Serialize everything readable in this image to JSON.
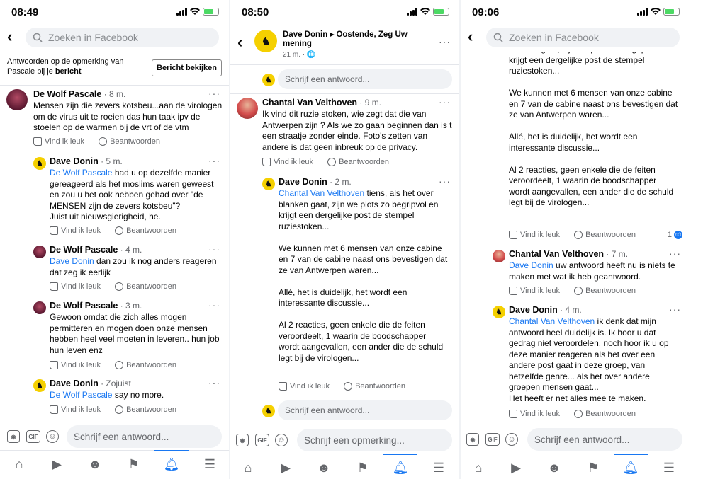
{
  "phones": [
    {
      "time": "08:49",
      "search_placeholder": "Zoeken in Facebook",
      "notice_text_1": "Antwoorden op de opmerking van",
      "notice_text_2": "Pascale bij je ",
      "notice_text_bold": "bericht",
      "notice_button": "Bericht bekijken",
      "comments": [
        {
          "name": "De Wolf Pascale",
          "time": " · 8 m.",
          "mention": "",
          "body": "Mensen zijn die zevers kotsbeu...aan de virologen\nom de virus uit te roeien das hun taak ipv de\nstoelen op de warmen bij de vrt of de vtm"
        },
        {
          "name": "Dave Donin",
          "time": " · 5 m.",
          "mention": "De Wolf Pascale",
          "body": " had u op dezelfde manier\ngereageerd als het moslims waren geweest\nen zou u het ook hebben gehad over \"de\nMENSEN zijn de zevers kotsbeu\"?\nJuist uit nieuwsgierigheid, he."
        },
        {
          "name": "De Wolf Pascale",
          "time": " · 4 m.",
          "mention": "Dave Donin",
          "body": " dan zou ik nog anders reageren\ndat zeg ik eerlijk"
        },
        {
          "name": "De Wolf Pascale",
          "time": " · 3 m.",
          "mention": "",
          "body": "Gewoon omdat die zich alles mogen\npermitteren en mogen doen onze mensen\nhebben heel veel moeten in leveren.. hun job\nhun leven enz"
        },
        {
          "name": "Dave Donin",
          "time": " · Zojuist",
          "mention": "De Wolf Pascale",
          "body": " say no more."
        }
      ],
      "compose_placeholder": "Schrijf een antwoord..."
    },
    {
      "time": "08:50",
      "post_author": "Dave Donin",
      "post_arrow": " ▸ ",
      "post_group": "Oostende, Zeg Uw mening",
      "post_sub": "21 m. · 🌐",
      "reply_placeholder": "Schrijf een antwoord...",
      "comments": [
        {
          "name": "Chantal Van Velthoven",
          "time": " · 9 m.",
          "mention": "",
          "body": "Ik vind dit ruzie stoken, wie zegt dat die van\nAntwerpen zijn ? Als we zo gaan beginnen dan is t\neen straatje zonder einde. Foto's zetten van\nandere is dat geen inbreuk op de privacy."
        },
        {
          "name": "Dave Donin",
          "time": " · 2 m.",
          "mention": "Chantal Van Velthoven",
          "body": " tiens, als het over\nblanken gaat, zijn we plots zo begripvol en\nkrijgt een dergelijke post de stempel\nruziestoken...\n\nWe kunnen met 6 mensen van onze cabine\nen 7 van de cabine naast ons bevestigen dat\nze van Antwerpen waren...\n\nAllé, het is duidelijk, het wordt een\ninteressante discussie...\n\nAl 2 reacties, geen enkele die de feiten\nveroordeelt,  1 waarin de boodschapper\nwordt aangevallen, een ander die de schuld\nlegt bij de virologen..."
        }
      ],
      "compose_placeholder": "Schrijf een opmerking..."
    },
    {
      "time": "09:06",
      "search_placeholder": "Zoeken in Facebook",
      "top_body": "blanken gaat, zijn we plots zo begripvol en\nkrijgt een dergelijke post de stempel\nruziestoken...\n\nWe kunnen met 6 mensen van onze cabine\nen 7 van de cabine naast ons bevestigen dat\nze van Antwerpen waren...\n\nAllé, het is duidelijk, het wordt een\ninteressante discussie...\n\nAl 2 reacties, geen enkele die de feiten\nveroordeelt,  1 waarin de boodschapper\nwordt aangevallen, een ander die de schuld\nlegt bij de virologen...",
      "like_count": "1",
      "comments": [
        {
          "name": "Chantal Van Velthoven",
          "time": " · 7 m.",
          "mention": "Dave Donin",
          "body": " uw antwoord heeft nu is niets te\nmaken met wat ik heb geantwoord."
        },
        {
          "name": "Dave Donin",
          "time": " · 4 m.",
          "mention": "Chantal Van Velthoven",
          "body": " ik denk dat mijn\nantwoord heel duidelijk is. Ik hoor u dat\ngedrag niet veroordelen, noch hoor ik u op\ndeze manier reageren als het over een\nandere post gaat in deze groep, van\nhetzelfde genre... als het over andere\ngroepen mensen gaat...\nHet heeft er net alles mee te maken."
        }
      ],
      "compose_placeholder": "Schrijf een antwoord..."
    }
  ],
  "actions": {
    "like": "Vind ik leuk",
    "reply": "Beantwoorden"
  },
  "icons": {
    "more": "···",
    "gif": "GIF"
  },
  "colors": {
    "accent": "#1877f2",
    "muted": "#65676b",
    "input_bg": "#f0f2f5"
  }
}
